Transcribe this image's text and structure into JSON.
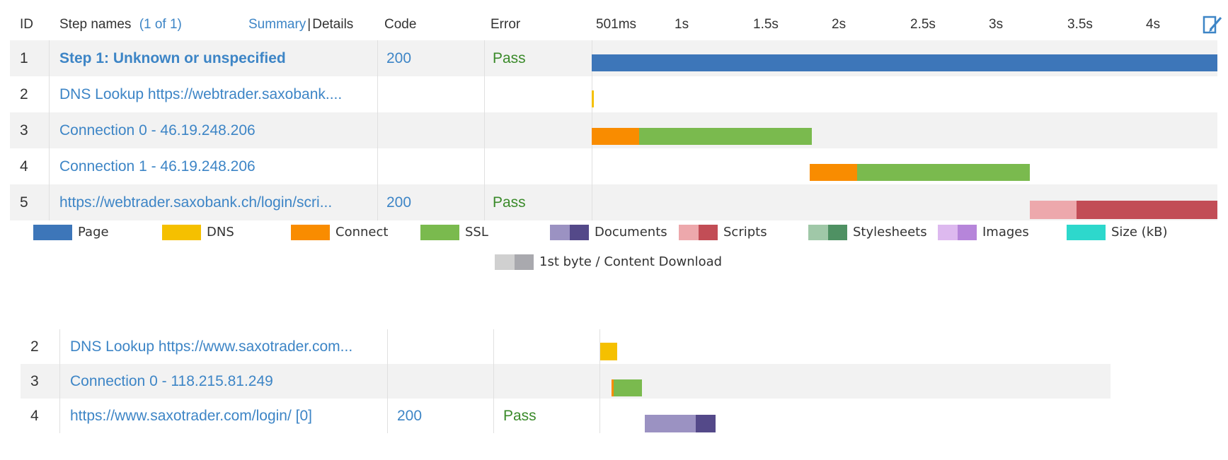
{
  "header": {
    "id": "ID",
    "step_names": "Step names",
    "step_count": "(1 of 1)",
    "summary": "Summary",
    "separator": "|",
    "details": "Details",
    "code": "Code",
    "error": "Error"
  },
  "timeline_ticks": [
    "501ms",
    "1s",
    "1.5s",
    "2s",
    "2.5s",
    "3s",
    "3.5s",
    "4s"
  ],
  "rows_top": [
    {
      "id": "1",
      "name": "Step 1: Unknown or unspecified",
      "code": "200",
      "error": "Pass"
    },
    {
      "id": "2",
      "name": "DNS Lookup https://webtrader.saxobank....",
      "code": "",
      "error": ""
    },
    {
      "id": "3",
      "name": "Connection 0 - 46.19.248.206",
      "code": "",
      "error": ""
    },
    {
      "id": "4",
      "name": "Connection 1 - 46.19.248.206",
      "code": "",
      "error": ""
    },
    {
      "id": "5",
      "name": "https://webtrader.saxobank.ch/login/scri...",
      "code": "200",
      "error": "Pass"
    }
  ],
  "legend": [
    {
      "label": "Page",
      "colors": [
        "#3d76b9"
      ]
    },
    {
      "label": "DNS",
      "colors": [
        "#f5c000"
      ]
    },
    {
      "label": "Connect",
      "colors": [
        "#f98c00"
      ]
    },
    {
      "label": "SSL",
      "colors": [
        "#7aba4e"
      ]
    },
    {
      "label": "Documents",
      "colors": [
        "#9b92c2",
        "#544989"
      ]
    },
    {
      "label": "Scripts",
      "colors": [
        "#eda8ac",
        "#c24d56"
      ]
    },
    {
      "label": "Stylesheets",
      "colors": [
        "#a0c8a8",
        "#4f9163"
      ]
    },
    {
      "label": "Images",
      "colors": [
        "#ddb9ef",
        "#b685da"
      ]
    },
    {
      "label": "Size (kB)",
      "colors": [
        "#2dd8cc"
      ]
    },
    {
      "label": "1st byte / Content Download",
      "colors": [
        "#d0d0d0",
        "#a9a9ae"
      ]
    }
  ],
  "rows_bottom": [
    {
      "id": "2",
      "name": "DNS Lookup https://www.saxotrader.com...",
      "code": "",
      "error": ""
    },
    {
      "id": "3",
      "name": "Connection 0 - 118.215.81.249",
      "code": "",
      "error": ""
    },
    {
      "id": "4",
      "name": "https://www.saxotrader.com/login/ [0]",
      "code": "200",
      "error": "Pass"
    }
  ],
  "colors": {
    "link": "#3d85c6",
    "pass": "#3a8a2a",
    "row_shade": "#f2f2f2"
  },
  "icons": {
    "edit": "edit-columns-icon"
  }
}
